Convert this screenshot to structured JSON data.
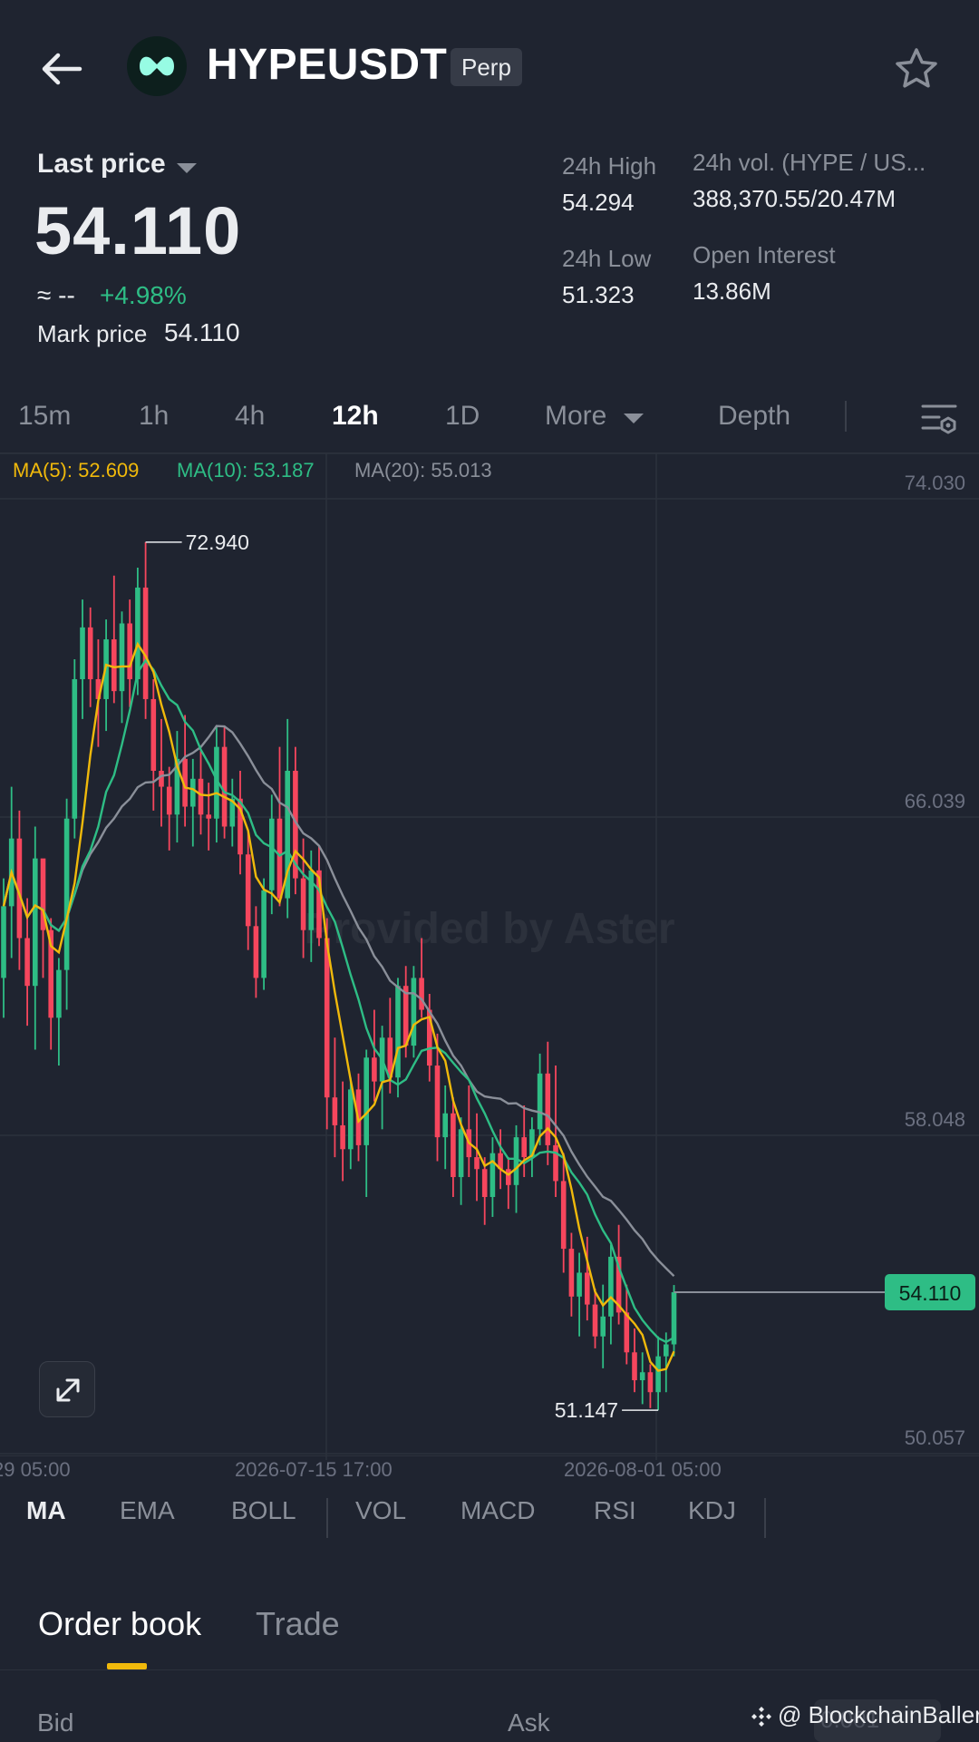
{
  "header": {
    "title": "HYPEUSDT",
    "badge": "Perp",
    "icons": [
      "back-arrow-icon",
      "hyperliquid-logo",
      "star-icon"
    ]
  },
  "ticker": {
    "last_price_label": "Last price",
    "last_price": "54.110",
    "approx": "≈ --",
    "change": "+4.98%",
    "mark_price_label": "Mark price",
    "mark_price": "54.110",
    "high_label": "24h High",
    "high_value": "54.294",
    "low_label": "24h Low",
    "low_value": "51.323",
    "vol_label": "24h vol. (HYPE / US...",
    "vol_value": "388,370.55/20.47M",
    "oi_label": "Open Interest",
    "oi_value": "13.86M"
  },
  "timeframes": {
    "items": [
      "15m",
      "1h",
      "4h",
      "12h",
      "1D"
    ],
    "active": "12h",
    "more": "More",
    "depth": "Depth"
  },
  "ma_legend": {
    "ma5": "MA(5): 52.609",
    "ma10": "MA(10): 53.187",
    "ma20": "MA(20): 55.013"
  },
  "colors": {
    "background": "#1f2430",
    "up": "#2ebd85",
    "down": "#f6465d",
    "ma5": "#f0b90b",
    "ma10": "#2ebd85",
    "ma20": "#8a8f99",
    "accent": "#f0b90b"
  },
  "chart_data": {
    "type": "candlestick",
    "price_axis": [
      "74.030",
      "66.039",
      "58.048",
      "50.057"
    ],
    "time_axis": [
      "29 05:00",
      "2026-07-15 17:00",
      "2026-08-01 05:00"
    ],
    "ylim": [
      50.057,
      74.03
    ],
    "grid": true,
    "high_marker": "72.940",
    "low_marker": "51.147",
    "current_price_tag": "54.110",
    "watermark": "Provided by Aster",
    "candles": [
      [
        62.0,
        64.5,
        61.0,
        63.8
      ],
      [
        63.8,
        66.8,
        62.5,
        65.5
      ],
      [
        65.5,
        66.2,
        62.2,
        63.0
      ],
      [
        63.0,
        64.0,
        60.8,
        61.8
      ],
      [
        61.8,
        65.8,
        60.2,
        65.0
      ],
      [
        65.0,
        64.0,
        62.0,
        63.2
      ],
      [
        63.2,
        63.5,
        60.2,
        61.0
      ],
      [
        61.0,
        62.5,
        59.8,
        62.2
      ],
      [
        62.2,
        66.5,
        61.2,
        66.0
      ],
      [
        66.0,
        70.0,
        65.5,
        69.5
      ],
      [
        69.5,
        71.5,
        68.5,
        70.8
      ],
      [
        70.8,
        71.3,
        68.8,
        69.5
      ],
      [
        69.5,
        70.5,
        67.8,
        69.0
      ],
      [
        69.0,
        71.0,
        68.2,
        70.5
      ],
      [
        70.5,
        72.1,
        68.9,
        69.2
      ],
      [
        69.2,
        71.2,
        68.4,
        70.9
      ],
      [
        70.9,
        71.5,
        68.8,
        69.5
      ],
      [
        69.5,
        72.3,
        69.1,
        71.8
      ],
      [
        71.8,
        72.94,
        68.5,
        69.0
      ],
      [
        69.0,
        69.5,
        66.2,
        67.2
      ],
      [
        67.2,
        68.5,
        65.8,
        66.8
      ],
      [
        66.8,
        67.3,
        65.2,
        66.1
      ],
      [
        66.1,
        68.2,
        65.4,
        67.5
      ],
      [
        67.5,
        68.6,
        65.8,
        66.3
      ],
      [
        66.3,
        67.5,
        65.3,
        67.0
      ],
      [
        67.0,
        67.7,
        65.6,
        66.1
      ],
      [
        66.1,
        66.9,
        65.2,
        66.0
      ],
      [
        66.0,
        68.3,
        65.4,
        67.8
      ],
      [
        67.8,
        68.3,
        65.5,
        65.8
      ],
      [
        65.8,
        67.0,
        65.3,
        66.5
      ],
      [
        66.5,
        67.2,
        64.6,
        65.1
      ],
      [
        65.1,
        65.7,
        62.7,
        63.3
      ],
      [
        63.3,
        63.8,
        61.5,
        62.0
      ],
      [
        62.0,
        64.5,
        61.7,
        64.2
      ],
      [
        64.2,
        66.6,
        63.6,
        66.0
      ],
      [
        66.0,
        67.8,
        63.8,
        64.0
      ],
      [
        64.0,
        68.5,
        63.5,
        67.2
      ],
      [
        67.2,
        67.8,
        64.1,
        64.5
      ],
      [
        64.5,
        65.5,
        62.5,
        63.2
      ],
      [
        63.2,
        65.2,
        62.4,
        64.7
      ],
      [
        64.7,
        65.3,
        62.8,
        63.0
      ],
      [
        63.0,
        63.5,
        58.2,
        59.0
      ],
      [
        59.0,
        60.5,
        57.5,
        58.3
      ],
      [
        58.3,
        59.4,
        56.9,
        57.7
      ],
      [
        57.7,
        59.5,
        57.2,
        59.2
      ],
      [
        59.2,
        59.6,
        57.4,
        57.8
      ],
      [
        57.8,
        60.2,
        56.5,
        60.0
      ],
      [
        60.0,
        61.2,
        58.9,
        59.4
      ],
      [
        59.4,
        60.8,
        58.2,
        60.5
      ],
      [
        60.5,
        61.5,
        59.1,
        59.5
      ],
      [
        59.5,
        62.0,
        59.0,
        61.8
      ],
      [
        61.8,
        62.3,
        60.0,
        60.3
      ],
      [
        60.3,
        62.3,
        60.0,
        62.0
      ],
      [
        62.0,
        63.0,
        61.0,
        61.2
      ],
      [
        61.2,
        61.6,
        59.4,
        59.8
      ],
      [
        59.8,
        60.6,
        57.4,
        58.0
      ],
      [
        58.0,
        59.3,
        57.2,
        58.6
      ],
      [
        58.6,
        59.0,
        56.5,
        57.0
      ],
      [
        57.0,
        58.5,
        56.3,
        58.2
      ],
      [
        58.2,
        59.3,
        57.0,
        57.5
      ],
      [
        57.5,
        58.6,
        56.4,
        57.2
      ],
      [
        57.2,
        57.5,
        55.8,
        56.5
      ],
      [
        56.5,
        58.0,
        56.0,
        57.6
      ],
      [
        57.6,
        58.2,
        56.7,
        57.2
      ],
      [
        57.2,
        57.5,
        56.2,
        56.8
      ],
      [
        56.8,
        58.3,
        56.1,
        58.0
      ],
      [
        58.0,
        58.8,
        57.0,
        57.5
      ],
      [
        57.5,
        58.5,
        57.0,
        58.2
      ],
      [
        58.2,
        60.1,
        57.8,
        59.6
      ],
      [
        59.6,
        60.4,
        57.3,
        57.8
      ],
      [
        57.8,
        59.8,
        56.5,
        56.9
      ],
      [
        56.9,
        57.6,
        54.6,
        55.2
      ],
      [
        55.2,
        55.6,
        53.5,
        54.0
      ],
      [
        54.0,
        55.1,
        53.0,
        54.6
      ],
      [
        54.6,
        55.5,
        53.4,
        53.8
      ],
      [
        53.8,
        54.2,
        52.7,
        53.0
      ],
      [
        53.0,
        54.3,
        52.2,
        53.5
      ],
      [
        53.5,
        55.3,
        52.8,
        55.0
      ],
      [
        55.0,
        55.8,
        53.3,
        53.6
      ],
      [
        53.6,
        54.3,
        52.3,
        52.6
      ],
      [
        52.6,
        53.2,
        51.6,
        51.9
      ],
      [
        51.9,
        52.6,
        51.3,
        52.1
      ],
      [
        52.1,
        52.3,
        51.2,
        51.6
      ],
      [
        51.6,
        53.0,
        51.147,
        52.5
      ],
      [
        52.5,
        53.1,
        51.6,
        52.8
      ],
      [
        52.8,
        54.29,
        52.5,
        54.11
      ]
    ]
  },
  "indicators": {
    "items": [
      "MA",
      "EMA",
      "BOLL",
      "VOL",
      "MACD",
      "RSI",
      "KDJ"
    ],
    "active": "MA"
  },
  "orderbook": {
    "tabs": [
      "Order book",
      "Trade"
    ],
    "active": "Order book",
    "bid_label": "Bid",
    "ask_label": "Ask",
    "precision_hint": "0.001",
    "watermark": "@ BlockchainBaller"
  }
}
